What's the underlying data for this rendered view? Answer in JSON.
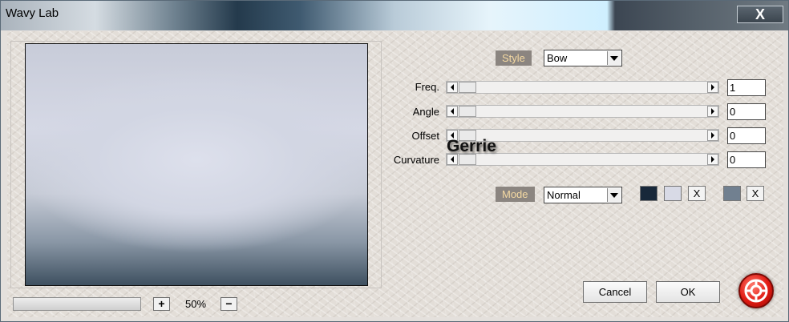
{
  "window": {
    "title": "Wavy Lab",
    "close_symbol": "X"
  },
  "preview": {
    "zoom": "50%",
    "zoom_in": "+",
    "zoom_out": "−"
  },
  "style": {
    "label": "Style",
    "value": "Bow"
  },
  "params": [
    {
      "label": "Freq.",
      "value": "1"
    },
    {
      "label": "Angle",
      "value": "0"
    },
    {
      "label": "Offset",
      "value": "0"
    },
    {
      "label": "Curvature",
      "value": "0"
    }
  ],
  "mode": {
    "label": "Mode",
    "value": "Normal"
  },
  "colors": {
    "swatch1": "#18283a",
    "swatch2": "#d8dae6",
    "swatch3": "#718090",
    "clear": "X"
  },
  "watermark": "Gerrie",
  "buttons": {
    "cancel": "Cancel",
    "ok": "OK"
  }
}
